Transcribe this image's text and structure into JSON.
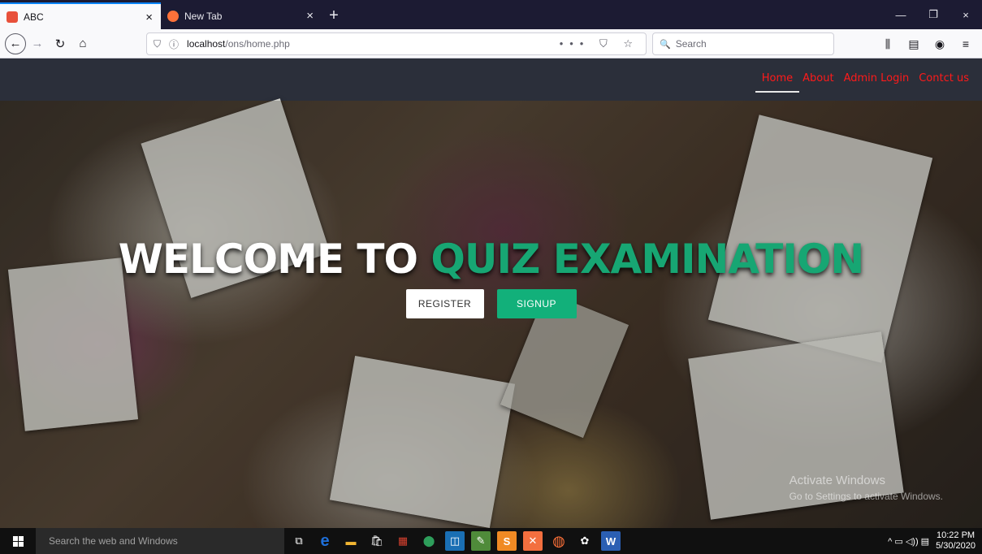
{
  "browser": {
    "tabs": [
      {
        "title": "ABC",
        "active": true,
        "favicon_color": "#e8503a"
      },
      {
        "title": "New Tab",
        "active": false,
        "favicon_color": "#ff7139"
      }
    ],
    "tab_close_glyph": "×",
    "new_tab_glyph": "+",
    "window_controls": {
      "minimize": "—",
      "restore": "❐",
      "close": "×"
    },
    "url": {
      "host": "localhost",
      "path": "/ons/home.php"
    },
    "page_actions": "••• ⛉ ☆",
    "search_placeholder": "Search",
    "icons": {
      "back": "←",
      "forward": "→",
      "reload": "↻",
      "home": "⌂",
      "shield": "⛉",
      "info": "ⓘ",
      "library": "⫼",
      "sidebar": "▤",
      "account": "◉",
      "menu": "≡",
      "search": "🔍"
    }
  },
  "site": {
    "nav": [
      {
        "label": "Home",
        "active": true
      },
      {
        "label": "About",
        "active": false
      },
      {
        "label": "Admin Login",
        "active": false
      },
      {
        "label": "Contct us",
        "active": false
      }
    ],
    "hero": {
      "title_part1": "WELCOME TO ",
      "title_part2": "QUIZ EXAMINATION",
      "register_label": "REGISTER",
      "signup_label": "SIGNUP"
    },
    "colors": {
      "accent": "#12b07a",
      "nav_link": "#ff1a1a",
      "header_bg": "#2b2f3a"
    }
  },
  "watermark": {
    "line1": "Activate Windows",
    "line2": "Go to Settings to activate Windows."
  },
  "taskbar": {
    "search_placeholder": "Search the web and Windows",
    "apps": [
      {
        "icon": "task-view",
        "glyph": "⧉",
        "color": "#101010"
      },
      {
        "icon": "edge",
        "glyph": "e",
        "color": "#1e6fd9"
      },
      {
        "icon": "file-explorer",
        "glyph": "▬",
        "color": "#f2b632"
      },
      {
        "icon": "store",
        "glyph": "🛍",
        "color": "#3a3a3a"
      },
      {
        "icon": "app-colorful",
        "glyph": "▦",
        "color": "#d8412f"
      },
      {
        "icon": "maps",
        "glyph": "⬤",
        "color": "#2e9e5b"
      },
      {
        "icon": "app-blue",
        "glyph": "◫",
        "color": "#1a6fb4"
      },
      {
        "icon": "notepad",
        "glyph": "✎",
        "color": "#4f8b3a"
      },
      {
        "icon": "sublime",
        "glyph": "S",
        "color": "#f08a24"
      },
      {
        "icon": "xampp",
        "glyph": "✕",
        "color": "#f36f3f"
      },
      {
        "icon": "firefox",
        "glyph": "◍",
        "color": "#ff7139"
      },
      {
        "icon": "paint",
        "glyph": "✿",
        "color": "#3a3a3a"
      },
      {
        "icon": "word",
        "glyph": "W",
        "color": "#2b5fb3"
      }
    ],
    "tray": {
      "icons": "^ ▭ ◁)) ▤",
      "time": "10:22 PM",
      "date": "5/30/2020"
    }
  }
}
